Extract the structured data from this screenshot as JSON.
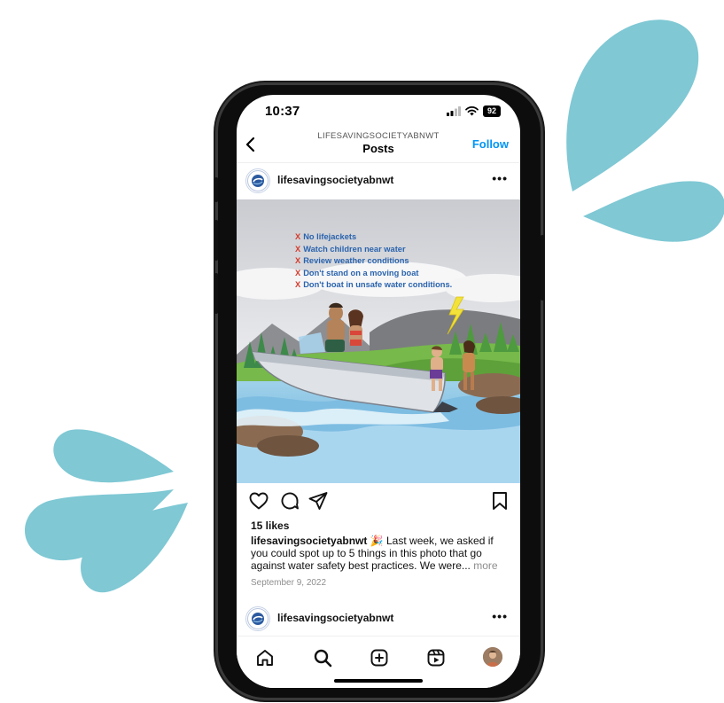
{
  "status_bar": {
    "time": "10:37",
    "battery": "92"
  },
  "nav": {
    "account": "LIFESAVINGSOCIETYABNWT",
    "title": "Posts",
    "follow_label": "Follow"
  },
  "post": {
    "username": "lifesavingsocietyabnwt",
    "checklist": [
      "No lifejackets",
      "Watch children near water",
      "Review weather conditions",
      "Don't stand on a moving boat",
      "Don't boat in unsafe water conditions."
    ],
    "checklist_marker": "X",
    "likes": "15 likes",
    "caption_username": "lifesavingsocietyabnwt",
    "caption_emoji": "🎉",
    "caption_text": " Last week, we asked if you could spot up to 5 things in this photo that go against water safety best practices. We were...",
    "caption_more": " more",
    "date": "September 9, 2022"
  },
  "next_post": {
    "username": "lifesavingsocietyabnwt"
  },
  "colors": {
    "accent": "#0095f6",
    "splash": "#7fc8d4",
    "checklist_text": "#2a63ad",
    "checklist_marker": "#d43b2c"
  },
  "icons": {
    "back": "chevron-left-icon",
    "more": "more-horizontal-icon",
    "like": "heart-icon",
    "comment": "comment-icon",
    "share": "send-icon",
    "save": "bookmark-icon",
    "home": "home-icon",
    "search": "search-icon",
    "create": "plus-square-icon",
    "reels": "reels-icon",
    "profile": "profile-avatar-icon"
  }
}
